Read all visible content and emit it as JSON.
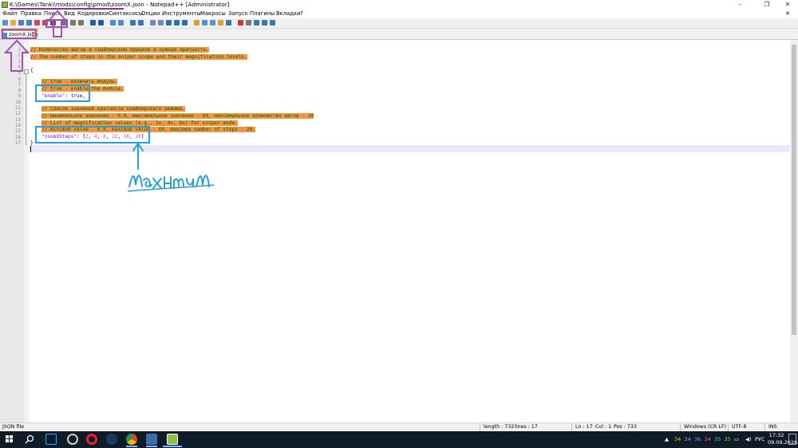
{
  "window": {
    "title": "K:\\Games\\Tanki\\mods\\config\\pmod\\zoomX.json - Notepad++ [Administrator]",
    "controls": {
      "minimize": "–",
      "restore": "❐",
      "close": "✕"
    }
  },
  "menu": {
    "items": [
      "Файл",
      "Правка",
      "Поиск",
      "Вид",
      "Кодировки",
      "Синтаксисы",
      "Опции",
      "Инструменты",
      "Макросы",
      "Запуск",
      "Плагины",
      "Вкладки",
      "?"
    ],
    "close": "✕"
  },
  "toolbar": {
    "icons": [
      "new-file-icon",
      "open-file-icon",
      "save-icon",
      "save-all-icon",
      "close-icon",
      "close-all-icon",
      "print-icon",
      "cut-icon",
      "copy-icon",
      "paste-icon",
      "undo-icon",
      "redo-icon",
      "find-icon",
      "replace-icon",
      "zoom-in-icon",
      "zoom-out-icon",
      "sync-v-icon",
      "sync-h-icon",
      "word-wrap-icon",
      "all-chars-icon",
      "indent-guide-icon",
      "udl-icon",
      "doc-map-icon",
      "func-list-icon",
      "folder-icon",
      "monitor-icon",
      "record-icon",
      "stop-icon",
      "play-icon",
      "play-multi-icon",
      "save-macro-icon"
    ]
  },
  "tabs": [
    {
      "label": "zoomX.json",
      "close": "✕",
      "active": true
    }
  ],
  "editor": {
    "line_numbers": [
      "1",
      "2",
      "3",
      "4",
      "5",
      "6",
      "7",
      "8",
      "9",
      "10",
      "11",
      "12",
      "13",
      "14",
      "15",
      "16",
      "17"
    ],
    "lines": {
      "l1": "// Количество шагов в снайперском прицеле и нужная кратность.",
      "l2": "// The number of steps in the sniper scope and their magnification levels.",
      "l5": "{",
      "l7": "// true - включить модуль.",
      "l8": "// true - enable the module.",
      "l9_key": "\"enable\"",
      "l9_rest": ": ",
      "l9_val": "true",
      "l9_end": ",",
      "l11": "// Список значений кратности снайперского режима.",
      "l12": "// минимальное значение - 0.8, максимальное значение - 60, максимальное количество шагов - 20",
      "l13": "// List of magnification values (e.g., 2x, 4x, 8x) for sniper mode.",
      "l14": "// minimum value - 0.8, maximum value - 60, maximum number of steps - 20.",
      "l15_key": "\"zoomXSteps\"",
      "l15_open": ": [",
      "l15_values": [
        "2",
        "4",
        "8",
        "12",
        "16",
        "20"
      ],
      "l15_close": "]",
      "l16": "}"
    }
  },
  "annotation": {
    "handwritten": "Maximum"
  },
  "status": {
    "filetype": "JSON file",
    "length": "length : 732",
    "lines": "lines : 17",
    "ln": "Ln : 17",
    "col": "Col : 1",
    "pos": "Pos : 733",
    "eol": "Windows (CR LF)",
    "encoding": "UTF-8",
    "mode": "INS"
  },
  "taskbar": {
    "tray_numbers": [
      "34",
      "34",
      "36",
      "34",
      "35",
      "35"
    ],
    "tray_colors": [
      "#f5c518",
      "#c87aff",
      "#5aa0ff",
      "#ff5c8a",
      "#36d4c8",
      "#7bd84a"
    ],
    "language": "РУС",
    "time": "17:32",
    "date": "09.09.2026"
  }
}
